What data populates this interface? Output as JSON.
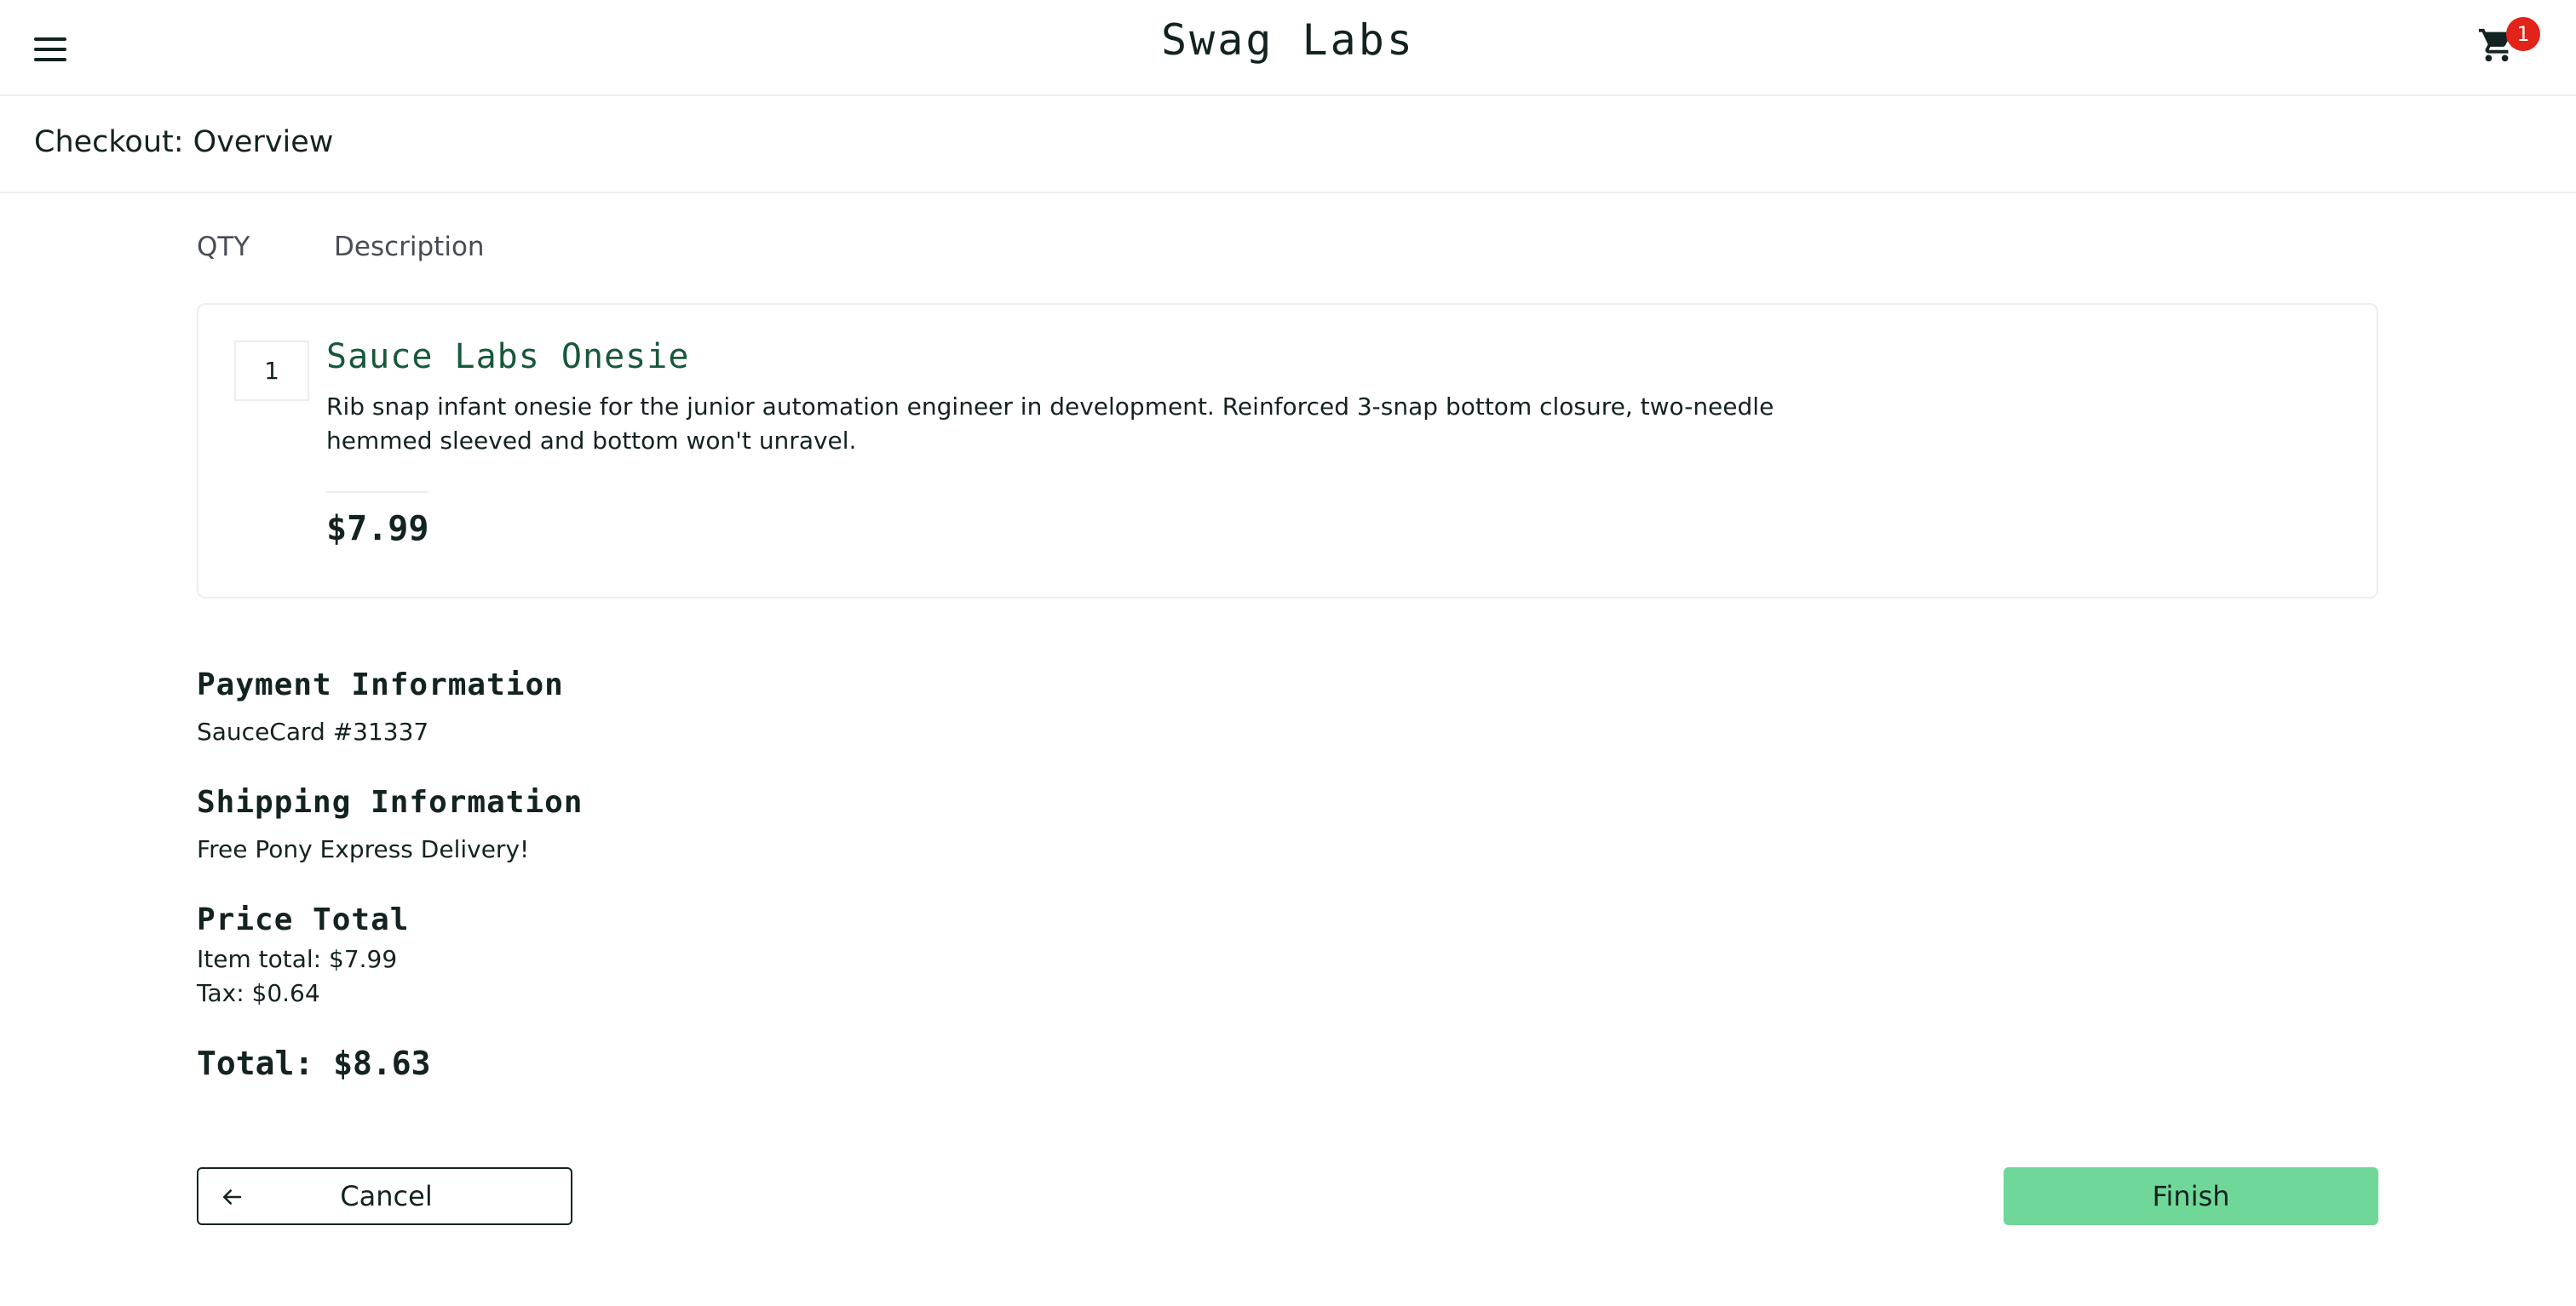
{
  "header": {
    "app_title": "Swag Labs",
    "menu_icon": "hamburger-menu-icon",
    "cart_icon": "shopping-cart-icon",
    "cart_badge_count": "1",
    "badge_color": "#e2231a"
  },
  "subheader": {
    "title": "Checkout: Overview"
  },
  "cart_list": {
    "qty_header": "QTY",
    "description_header": "Description",
    "items": [
      {
        "quantity": "1",
        "name": "Sauce Labs Onesie",
        "description": "Rib snap infant onesie for the junior automation engineer in development. Reinforced 3-snap bottom closure, two-needle hemmed sleeved and bottom won't unravel.",
        "price": "$7.99"
      }
    ]
  },
  "summary": {
    "payment_label": "Payment Information",
    "payment_value": "SauceCard #31337",
    "shipping_label": "Shipping Information",
    "shipping_value": "Free Pony Express Delivery!",
    "price_total_label": "Price Total",
    "item_total": "Item total: $7.99",
    "tax": "Tax: $0.64",
    "total": "Total: $8.63"
  },
  "actions": {
    "cancel_label": "Cancel",
    "cancel_icon": "arrow-left-icon",
    "finish_label": "Finish",
    "finish_color": "#6fd898",
    "item_name_color": "#18583a"
  }
}
